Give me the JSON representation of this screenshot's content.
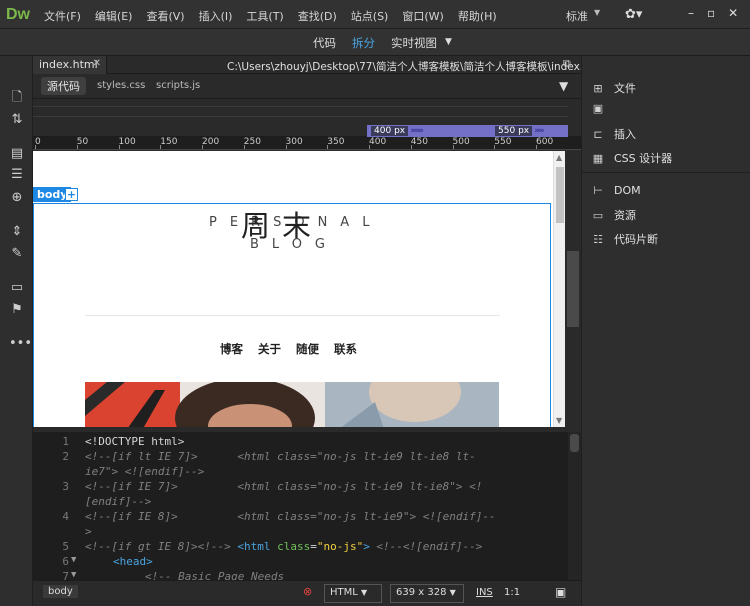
{
  "app": {
    "logo": "Dw"
  },
  "menu": [
    "文件(F)",
    "编辑(E)",
    "查看(V)",
    "插入(I)",
    "工具(T)",
    "查找(D)",
    "站点(S)",
    "窗口(W)",
    "帮助(H)"
  ],
  "workspace": {
    "label": "标准"
  },
  "views": {
    "code": "代码",
    "split": "拆分",
    "live": "实时视图"
  },
  "document": {
    "tab": "index.html",
    "path": "C:\\Users\\zhouyj\\Desktop\\77\\简洁个人博客模板\\简洁个人博客模板\\index.html",
    "source_btn": "源代码",
    "related_files": [
      "styles.css",
      "scripts.js"
    ]
  },
  "media_queries": [
    {
      "label": "400",
      "unit": "px"
    },
    {
      "label": "550",
      "unit": "px"
    }
  ],
  "ruler": [
    "0",
    "50",
    "100",
    "150",
    "200",
    "250",
    "300",
    "350",
    "400",
    "450",
    "500",
    "550",
    "600"
  ],
  "live_view": {
    "body_tag": "body",
    "title_en": "PERSONAL",
    "title_cn": "周末",
    "subtitle": "BLOG",
    "nav": [
      "博客",
      "关于",
      "随便",
      "联系"
    ]
  },
  "code": {
    "line_numbers": [
      "1",
      "",
      "2",
      "",
      "3",
      "",
      "4",
      "",
      "5",
      "6",
      "7"
    ],
    "lines": [
      {
        "n": "1",
        "text": "<!DOCTYPE html>"
      },
      {
        "n": "2",
        "a": "<!--[if lt IE 7]>      ",
        "b": "<html class=\"no-js lt-ie9 lt-ie8 lt-",
        "c": "ie7\"> <![endif]-->"
      },
      {
        "n": "3",
        "a": "<!--[if IE 7]>         ",
        "b": "<html class=\"no-js lt-ie9 lt-ie8\"> <!",
        "c": "[endif]-->"
      },
      {
        "n": "4",
        "a": "<!--[if IE 8]>         ",
        "b": "<html class=\"no-js lt-ie9\"> <![endif]--",
        "c": ">"
      },
      {
        "n": "5",
        "a": "<!--[if gt IE 8]><!--> ",
        "tag": "<html ",
        "attr": "class",
        "eq": "=",
        "str": "\"no-js\"",
        "end": ">",
        "tail": " <!--<![endif]-->"
      },
      {
        "n": "6",
        "text": "<head>"
      },
      {
        "n": "7",
        "text": "<!-- Basic Page Needs"
      }
    ]
  },
  "status": {
    "tag": "body",
    "lang": "HTML",
    "size": "639 x 328",
    "ins": "INS",
    "pos": "1:1"
  },
  "panels": [
    "文件",
    "插入",
    "CSS 设计器",
    "DOM",
    "资源",
    "代码片断"
  ]
}
